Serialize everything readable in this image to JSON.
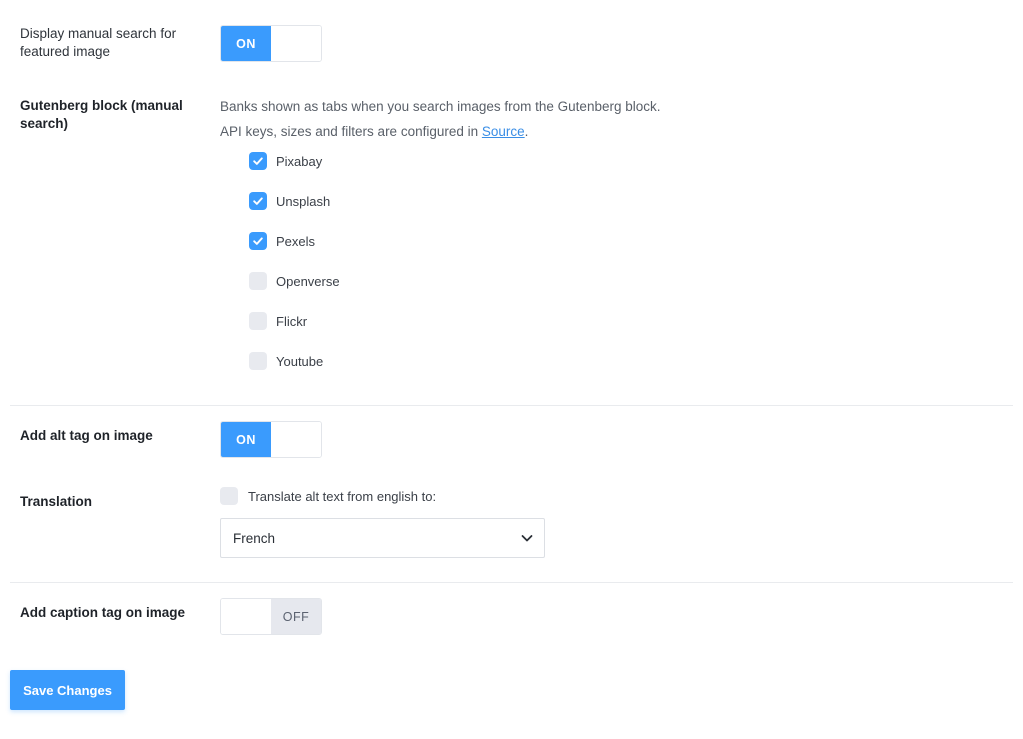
{
  "settings": {
    "manual_search": {
      "label": "Display manual search for featured image",
      "state_label": "ON"
    },
    "gutenberg": {
      "label": "Gutenberg block (manual search)",
      "desc_line1": "Banks shown as tabs when you search images from the Gutenberg block.",
      "desc_line2_prefix": "API keys, sizes and filters are configured in ",
      "desc_link": "Source",
      "desc_line2_suffix": ".",
      "banks": [
        {
          "label": "Pixabay",
          "checked": true
        },
        {
          "label": "Unsplash",
          "checked": true
        },
        {
          "label": "Pexels",
          "checked": true
        },
        {
          "label": "Openverse",
          "checked": false
        },
        {
          "label": "Flickr",
          "checked": false
        },
        {
          "label": "Youtube",
          "checked": false
        }
      ]
    },
    "alt_tag": {
      "label": "Add alt tag on image",
      "state_label": "ON"
    },
    "translation": {
      "label": "Translation",
      "checkbox_label": "Translate alt text from english to:",
      "checked": false,
      "selected_language": "French"
    },
    "caption_tag": {
      "label": "Add caption tag on image",
      "state_label": "OFF"
    }
  },
  "actions": {
    "save_label": "Save Changes"
  },
  "colors": {
    "accent": "#3a9bfd",
    "off_bg": "#e6e8ee",
    "link": "#3a8ee6"
  }
}
